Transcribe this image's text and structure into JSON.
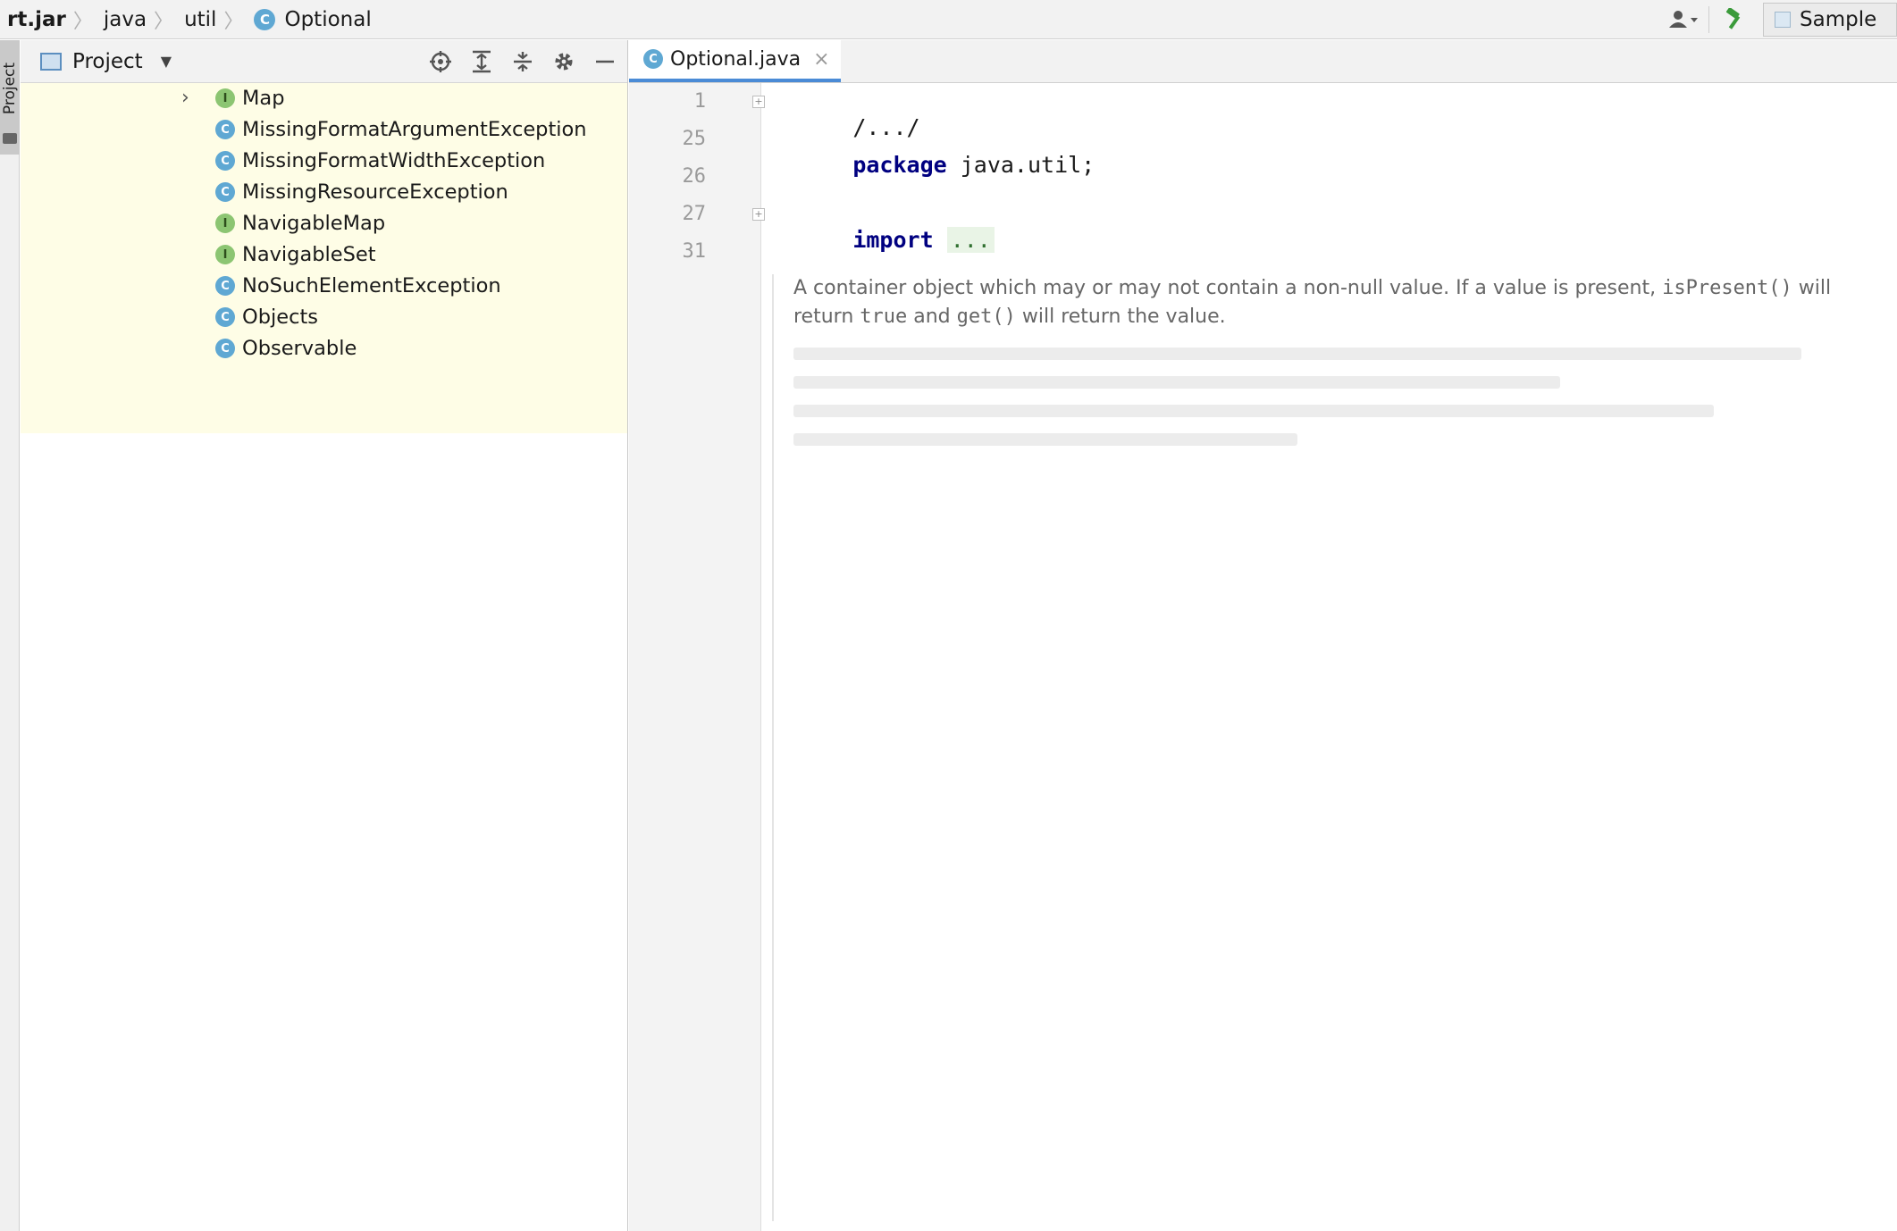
{
  "breadcrumbs": [
    {
      "label": "rt.jar"
    },
    {
      "label": "java"
    },
    {
      "label": "util"
    },
    {
      "label": "Optional",
      "badge": "C"
    }
  ],
  "toolbar": {
    "user_icon": "user-icon",
    "build_icon": "hammer-icon",
    "run_config": "Sample"
  },
  "left_stripe": {
    "project_label": "Project"
  },
  "project_panel": {
    "title": "Project",
    "tools": [
      "locate-icon",
      "expand-all-icon",
      "collapse-all-icon",
      "gear-icon",
      "minimize-icon"
    ],
    "tree": [
      {
        "type": "I",
        "label": "Map",
        "expandable": true
      },
      {
        "type": "C",
        "label": "MissingFormatArgumentException"
      },
      {
        "type": "C",
        "label": "MissingFormatWidthException"
      },
      {
        "type": "C",
        "label": "MissingResourceException"
      },
      {
        "type": "I",
        "label": "NavigableMap"
      },
      {
        "type": "I",
        "label": "NavigableSet"
      },
      {
        "type": "C",
        "label": "NoSuchElementException"
      },
      {
        "type": "C",
        "label": "Objects"
      },
      {
        "type": "C",
        "label": "Observable"
      }
    ]
  },
  "editor": {
    "tab": {
      "label": "Optional.java",
      "badge": "C"
    },
    "lines": [
      {
        "num": "1",
        "text": "/.../"
      },
      {
        "num": "25",
        "keyword": "package",
        "rest": " java.util;"
      },
      {
        "num": "26",
        "text": ""
      },
      {
        "num": "27",
        "keyword": "import",
        "folded": "..."
      },
      {
        "num": "31",
        "text": ""
      }
    ],
    "javadoc": {
      "part1": "A container object which may or may not contain a non-null value. If a value is present, ",
      "code1": "isPresent()",
      "part2": " will return ",
      "code2": "true",
      "part3": " and ",
      "code3": "get()",
      "part4": " will return the value."
    }
  },
  "colors": {
    "accent": "#4a8bd6",
    "keyword": "#000080",
    "tree_background": "#fefde6",
    "class_icon": "#5fa8d3",
    "interface_icon": "#8cc572"
  }
}
